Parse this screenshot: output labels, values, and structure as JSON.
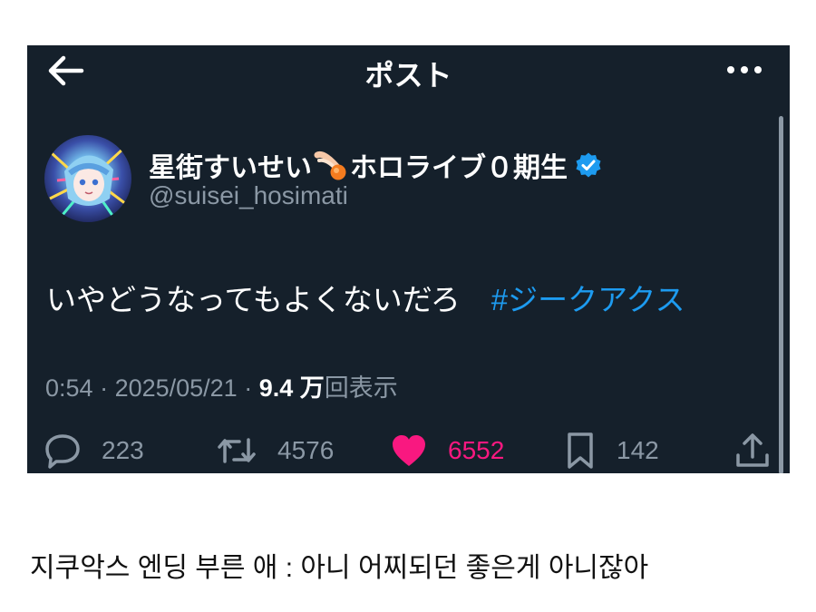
{
  "header": {
    "title": "ポスト"
  },
  "author": {
    "name_part1": "星街すいせい",
    "name_part2": "ホロライブ０期生",
    "handle": "@suisei_hosimati"
  },
  "post": {
    "text": "いやどうなってもよくないだろ",
    "hashtag": "#ジークアクス"
  },
  "meta": {
    "time": "0:54",
    "sep1": " · ",
    "date": "2025/05/21",
    "sep2": " · ",
    "views": "9.4 万",
    "views_suffix": "回表示"
  },
  "actions": {
    "replies": "223",
    "reposts": "4576",
    "likes": "6552",
    "bookmarks": "142"
  },
  "colors": {
    "background": "#15202b",
    "link": "#1d9bf0",
    "like": "#f91880",
    "muted": "#8b98a5"
  },
  "icons": [
    "back-arrow-icon",
    "more-icon",
    "comet-emoji-icon",
    "verified-badge-icon",
    "reply-icon",
    "repost-icon",
    "like-icon",
    "bookmark-icon",
    "share-icon"
  ],
  "caption": "지쿠악스 엔딩 부른 애 : 아니 어찌되던 좋은게 아니잖아"
}
